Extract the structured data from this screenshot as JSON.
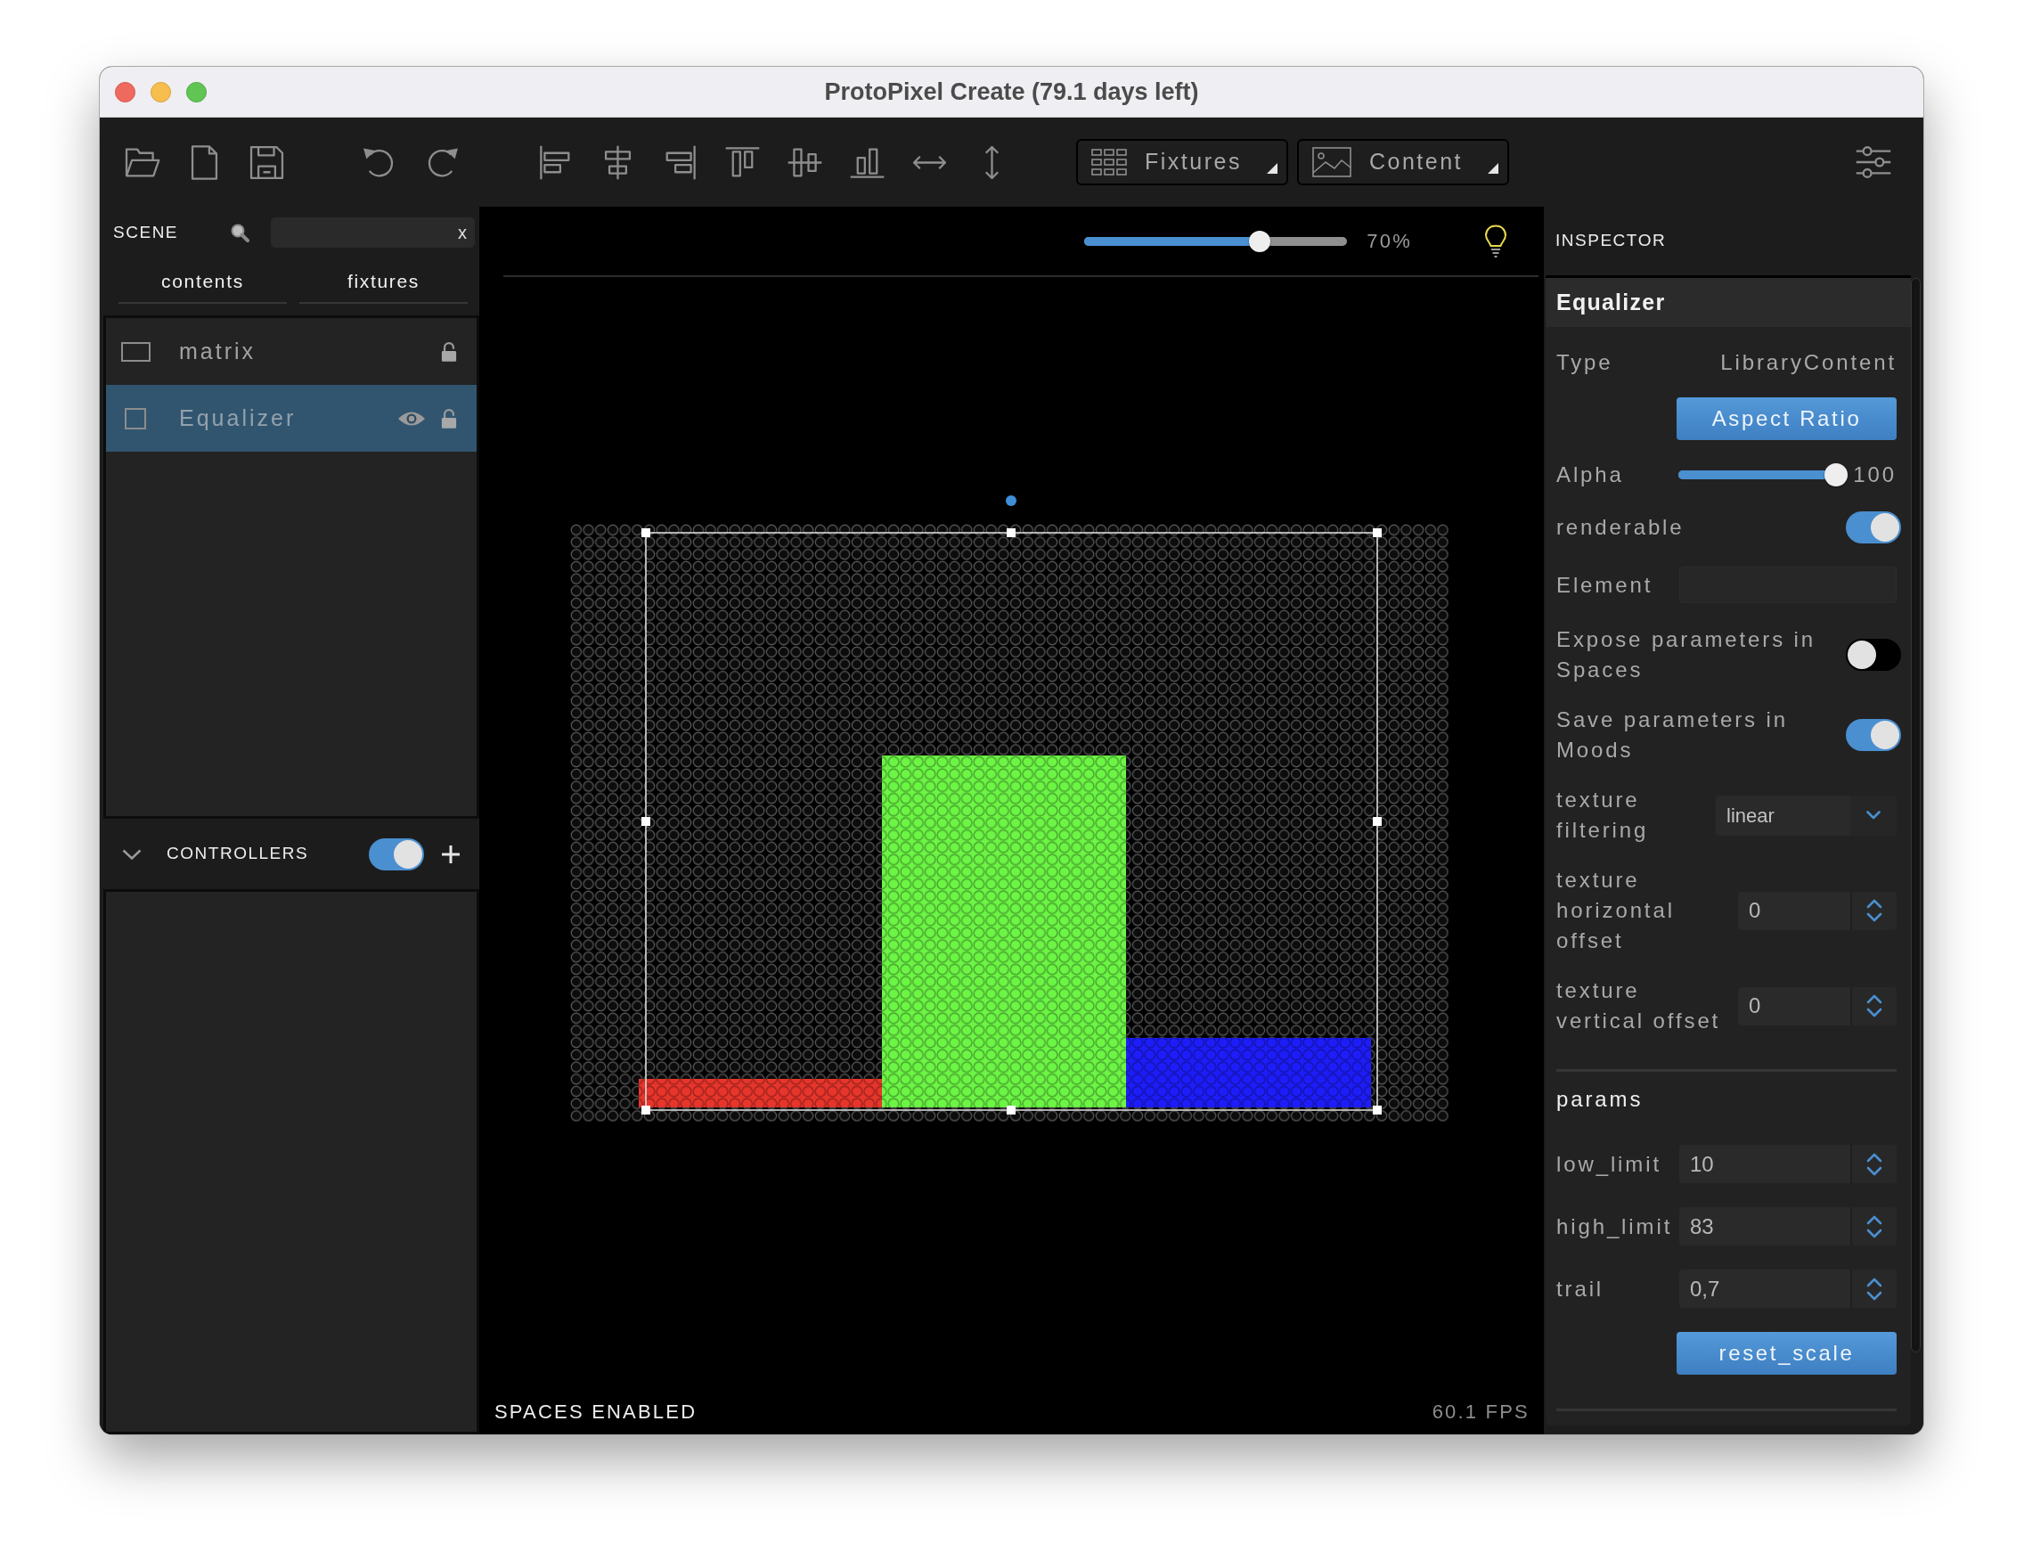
{
  "window": {
    "title": "ProtoPixel Create (79.1 days left)"
  },
  "toolbar": {
    "menus": [
      {
        "label": "Fixtures"
      },
      {
        "label": "Content"
      }
    ]
  },
  "scene": {
    "title": "SCENE",
    "search": {
      "clear_button": "x"
    },
    "tabs": [
      {
        "label": "contents"
      },
      {
        "label": "fixtures"
      }
    ],
    "items": [
      {
        "label": "matrix",
        "kind": "matrix",
        "selected": false,
        "visible": false
      },
      {
        "label": "Equalizer",
        "kind": "content",
        "selected": true,
        "visible": true
      }
    ]
  },
  "controllers": {
    "title": "CONTROLLERS",
    "expanded": true,
    "on": true
  },
  "canvas": {
    "zoom": {
      "level": 0.68,
      "reading": "70%"
    },
    "status": "SPACES ENABLED",
    "fps": "60.1 FPS"
  },
  "inspector": {
    "title": "INSPECTOR",
    "object_name": "Equalizer",
    "properties": [
      {
        "kind": "text",
        "label": "Type",
        "value": "LibraryContent"
      },
      {
        "kind": "button",
        "label": "Aspect Ratio"
      },
      {
        "kind": "slider",
        "label": "Alpha",
        "level": 1,
        "reading": "100"
      },
      {
        "kind": "toggle",
        "label": "renderable",
        "on": true
      },
      {
        "kind": "field",
        "label": "Element"
      },
      {
        "kind": "toggle",
        "label": "Expose parameters in Spaces",
        "on": false
      },
      {
        "kind": "toggle",
        "label": "Save parameters in Moods",
        "on": true
      },
      {
        "kind": "select",
        "label": "texture filtering",
        "value": "linear"
      },
      {
        "kind": "spin",
        "label": "texture horizontal offset",
        "value": "0"
      },
      {
        "kind": "spin",
        "label": "texture vertical offset",
        "value": "0"
      }
    ],
    "params_title": "params",
    "params": [
      {
        "kind": "spin",
        "label": "low_limit",
        "value": "10"
      },
      {
        "kind": "spin",
        "label": "high_limit",
        "value": "83"
      },
      {
        "kind": "spin",
        "label": "trail",
        "value": "0,7"
      },
      {
        "kind": "button",
        "label": "reset_scale"
      }
    ]
  }
}
